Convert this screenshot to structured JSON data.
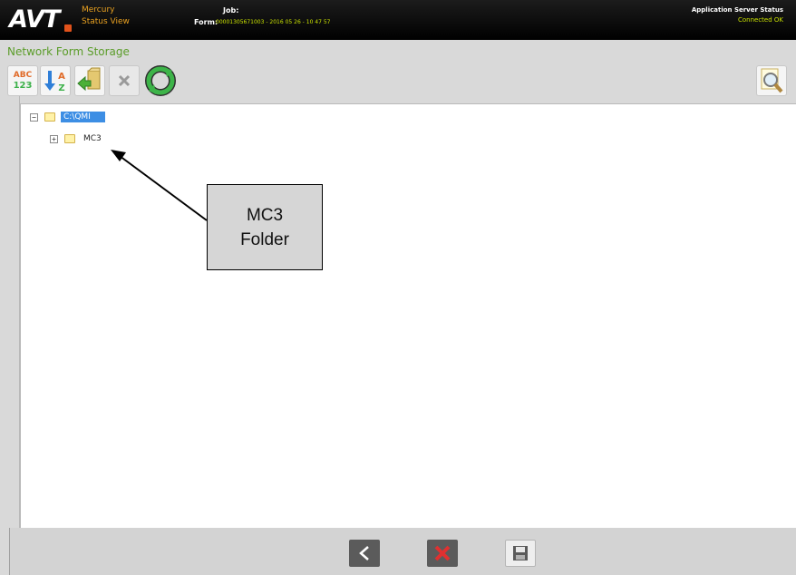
{
  "header": {
    "logo": "AVT",
    "app_name_line1": "Mercury",
    "app_name_line2": "Status View",
    "job_label": "Job:",
    "form_label": "Form:",
    "form_value": "00001305671003 - 2016 05 26 - 10 47 57",
    "server_status_title": "Application Server Status",
    "server_status_value": "Connected OK"
  },
  "section": {
    "title": "Network Form Storage"
  },
  "toolbar": {
    "abc_top": "ABC",
    "abc_bottom": "123",
    "sort_top": "A",
    "sort_bottom": "Z"
  },
  "tree": {
    "nodes": [
      {
        "label": "C:\\QMI",
        "toggle": "−",
        "selected": true
      },
      {
        "label": "MC3",
        "toggle": "+",
        "selected": false
      }
    ]
  },
  "callout": {
    "line1": "MC3",
    "line2": "Folder"
  },
  "colors": {
    "header_bg": "#000000",
    "accent_green": "#5a9c28",
    "selection_blue": "#3d8ee4",
    "panel_gray": "#d9d9d9"
  }
}
